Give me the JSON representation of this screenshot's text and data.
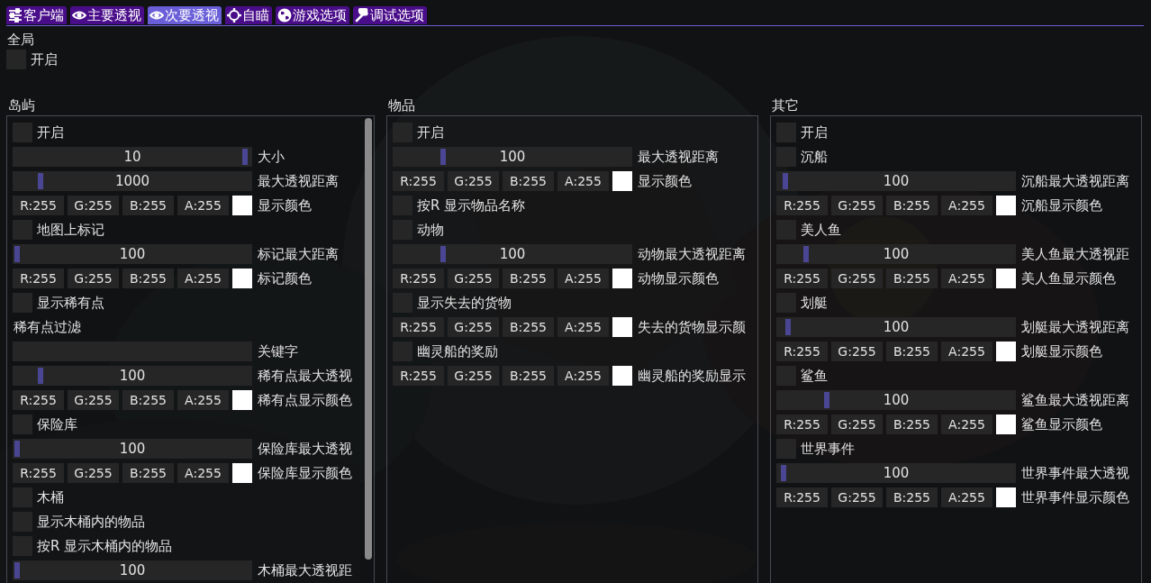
{
  "tabs": [
    {
      "label": "客户端",
      "selected": false
    },
    {
      "label": "主要透视",
      "selected": false
    },
    {
      "label": "次要透视",
      "selected": true
    },
    {
      "label": "自瞄",
      "selected": false
    },
    {
      "label": "游戏选项",
      "selected": false
    },
    {
      "label": "调试选项",
      "selected": false
    }
  ],
  "global": {
    "title": "全局",
    "items": [
      {
        "kind": "checkbox",
        "label": "开启",
        "checked": false
      }
    ]
  },
  "panels": [
    {
      "title": "岛屿",
      "scrollable": true,
      "rows": [
        {
          "kind": "checkbox",
          "label": "开启",
          "checked": false
        },
        {
          "kind": "slider",
          "reading": "10",
          "level": 0.99,
          "label": "大小"
        },
        {
          "kind": "slider",
          "reading": "1000",
          "level": 0.1,
          "label": "最大透视距离"
        },
        {
          "kind": "color",
          "r": "R:255",
          "g": "G:255",
          "b": "B:255",
          "a": "A:255",
          "color": "#ffffff",
          "label": "显示颜色"
        },
        {
          "kind": "checkbox",
          "label": "地图上标记",
          "checked": false
        },
        {
          "kind": "slider",
          "reading": "100",
          "level": 0.0,
          "label": "标记最大距离"
        },
        {
          "kind": "color",
          "r": "R:255",
          "g": "G:255",
          "b": "B:255",
          "a": "A:255",
          "color": "#ffffff",
          "label": "标记颜色"
        },
        {
          "kind": "checkbox",
          "label": "显示稀有点",
          "checked": false
        },
        {
          "kind": "text",
          "label": "稀有点过滤"
        },
        {
          "kind": "input",
          "label": "关键字"
        },
        {
          "kind": "slider",
          "reading": "100",
          "level": 0.1,
          "label": "稀有点最大透视"
        },
        {
          "kind": "color",
          "r": "R:255",
          "g": "G:255",
          "b": "B:255",
          "a": "A:255",
          "color": "#ffffff",
          "label": "稀有点显示颜色"
        },
        {
          "kind": "checkbox",
          "label": "保险库",
          "checked": false
        },
        {
          "kind": "slider",
          "reading": "100",
          "level": 0.0,
          "label": "保险库最大透视"
        },
        {
          "kind": "color",
          "r": "R:255",
          "g": "G:255",
          "b": "B:255",
          "a": "A:255",
          "color": "#ffffff",
          "label": "保险库显示颜色"
        },
        {
          "kind": "checkbox",
          "label": "木桶",
          "checked": false
        },
        {
          "kind": "checkbox",
          "label": "显示木桶内的物品",
          "checked": false
        },
        {
          "kind": "checkbox",
          "label": "按R 显示木桶内的物品",
          "checked": false
        },
        {
          "kind": "slider",
          "reading": "100",
          "level": 0.0,
          "label": "木桶最大透视距"
        }
      ]
    },
    {
      "title": "物品",
      "scrollable": false,
      "rows": [
        {
          "kind": "checkbox",
          "label": "开启",
          "checked": false
        },
        {
          "kind": "slider",
          "reading": "100",
          "level": 0.2,
          "label": "最大透视距离"
        },
        {
          "kind": "color",
          "r": "R:255",
          "g": "G:255",
          "b": "B:255",
          "a": "A:255",
          "color": "#ffffff",
          "label": "显示颜色"
        },
        {
          "kind": "checkbox",
          "label": "按R 显示物品名称",
          "checked": false
        },
        {
          "kind": "checkbox",
          "label": "动物",
          "checked": false
        },
        {
          "kind": "slider",
          "reading": "100",
          "level": 0.2,
          "label": "动物最大透视距离"
        },
        {
          "kind": "color",
          "r": "R:255",
          "g": "G:255",
          "b": "B:255",
          "a": "A:255",
          "color": "#ffffff",
          "label": "动物显示颜色"
        },
        {
          "kind": "checkbox",
          "label": "显示失去的货物",
          "checked": false
        },
        {
          "kind": "color",
          "r": "R:255",
          "g": "G:255",
          "b": "B:255",
          "a": "A:255",
          "color": "#ffffff",
          "label": "失去的货物显示颜"
        },
        {
          "kind": "checkbox",
          "label": "幽灵船的奖励",
          "checked": false
        },
        {
          "kind": "color",
          "r": "R:255",
          "g": "G:255",
          "b": "B:255",
          "a": "A:255",
          "color": "#ffffff",
          "label": "幽灵船的奖励显示"
        }
      ]
    },
    {
      "title": "其它",
      "scrollable": false,
      "rows": [
        {
          "kind": "checkbox",
          "label": "开启",
          "checked": false
        },
        {
          "kind": "checkbox",
          "label": "沉船",
          "checked": false
        },
        {
          "kind": "slider",
          "reading": "100",
          "level": 0.02,
          "label": "沉船最大透视距离"
        },
        {
          "kind": "color",
          "r": "R:255",
          "g": "G:255",
          "b": "B:255",
          "a": "A:255",
          "color": "#ffffff",
          "label": "沉船显示颜色"
        },
        {
          "kind": "checkbox",
          "label": "美人鱼",
          "checked": false
        },
        {
          "kind": "slider",
          "reading": "100",
          "level": 0.11,
          "label": "美人鱼最大透视距"
        },
        {
          "kind": "color",
          "r": "R:255",
          "g": "G:255",
          "b": "B:255",
          "a": "A:255",
          "color": "#ffffff",
          "label": "美人鱼显示颜色"
        },
        {
          "kind": "checkbox",
          "label": "划艇",
          "checked": false
        },
        {
          "kind": "slider",
          "reading": "100",
          "level": 0.03,
          "label": "划艇最大透视距离"
        },
        {
          "kind": "color",
          "r": "R:255",
          "g": "G:255",
          "b": "B:255",
          "a": "A:255",
          "color": "#ffffff",
          "label": "划艇显示颜色"
        },
        {
          "kind": "checkbox",
          "label": "鲨鱼",
          "checked": false
        },
        {
          "kind": "slider",
          "reading": "100",
          "level": 0.2,
          "label": "鲨鱼最大透视距离"
        },
        {
          "kind": "color",
          "r": "R:255",
          "g": "G:255",
          "b": "B:255",
          "a": "A:255",
          "color": "#ffffff",
          "label": "鲨鱼显示颜色"
        },
        {
          "kind": "checkbox",
          "label": "世界事件",
          "checked": false
        },
        {
          "kind": "slider",
          "reading": "100",
          "level": 0.01,
          "label": "世界事件最大透视"
        },
        {
          "kind": "color",
          "r": "R:255",
          "g": "G:255",
          "b": "B:255",
          "a": "A:255",
          "color": "#ffffff",
          "label": "世界事件显示颜色"
        }
      ]
    }
  ]
}
